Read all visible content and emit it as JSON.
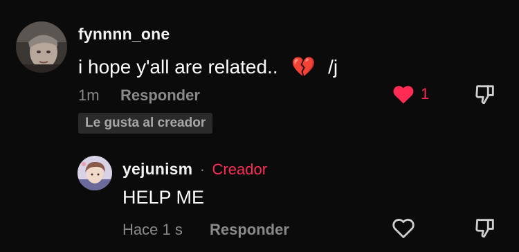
{
  "comment": {
    "username": "fynnnn_one",
    "text": "i hope y'all are related..",
    "emoji": "💔",
    "suffix": "/j",
    "time": "1m",
    "reply_label": "Responder",
    "like_count": "1",
    "creator_liked_badge": "Le gusta al creador"
  },
  "reply": {
    "username": "yejunism",
    "separator": "·",
    "creator_tag": "Creador",
    "text": "HELP ME",
    "time": "Hace 1 s",
    "reply_label": "Responder"
  },
  "colors": {
    "background": "#0b0b0b",
    "accent": "#fe2c55",
    "muted": "#8a8a8a"
  },
  "icons": {
    "liked": "heart-filled-icon",
    "unliked": "heart-outline-icon",
    "dislike": "thumbs-down-icon"
  }
}
